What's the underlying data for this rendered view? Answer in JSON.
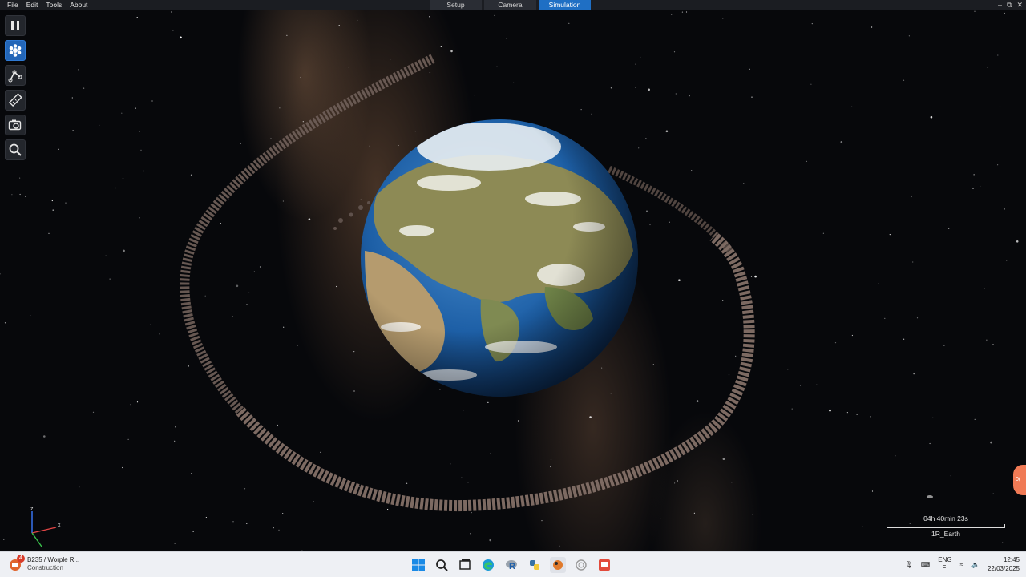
{
  "menu": {
    "items": [
      "File",
      "Edit",
      "Tools",
      "About"
    ]
  },
  "tabs": [
    {
      "label": "Setup",
      "active": false
    },
    {
      "label": "Camera",
      "active": false
    },
    {
      "label": "Simulation",
      "active": true
    }
  ],
  "toolbar": {
    "tools": [
      {
        "icon": "pause-icon",
        "active": false
      },
      {
        "icon": "molecule-icon",
        "active": true
      },
      {
        "icon": "path-nodes-icon",
        "active": false
      },
      {
        "icon": "ruler-icon",
        "active": false
      },
      {
        "icon": "camera-settings-icon",
        "active": false
      },
      {
        "icon": "search-icon",
        "active": false
      }
    ]
  },
  "axes": {
    "z": "z",
    "x": "x",
    "y": "y"
  },
  "overlay": {
    "sim_time": "04h 40min 23s",
    "scale_label": "1R_Earth"
  },
  "taskbar": {
    "app_title": "B235 / Worple R...",
    "app_subtitle": "Construction",
    "badge": "4",
    "lang_top": "ENG",
    "lang_bottom": "FI",
    "time": "12:45",
    "date": "22/03/2025"
  },
  "colors": {
    "accent": "#1f6fc4",
    "menubar": "#1b1d22",
    "ocean": "#1f63a8",
    "land": "#8d8a55",
    "debris": "#7d6a62"
  }
}
